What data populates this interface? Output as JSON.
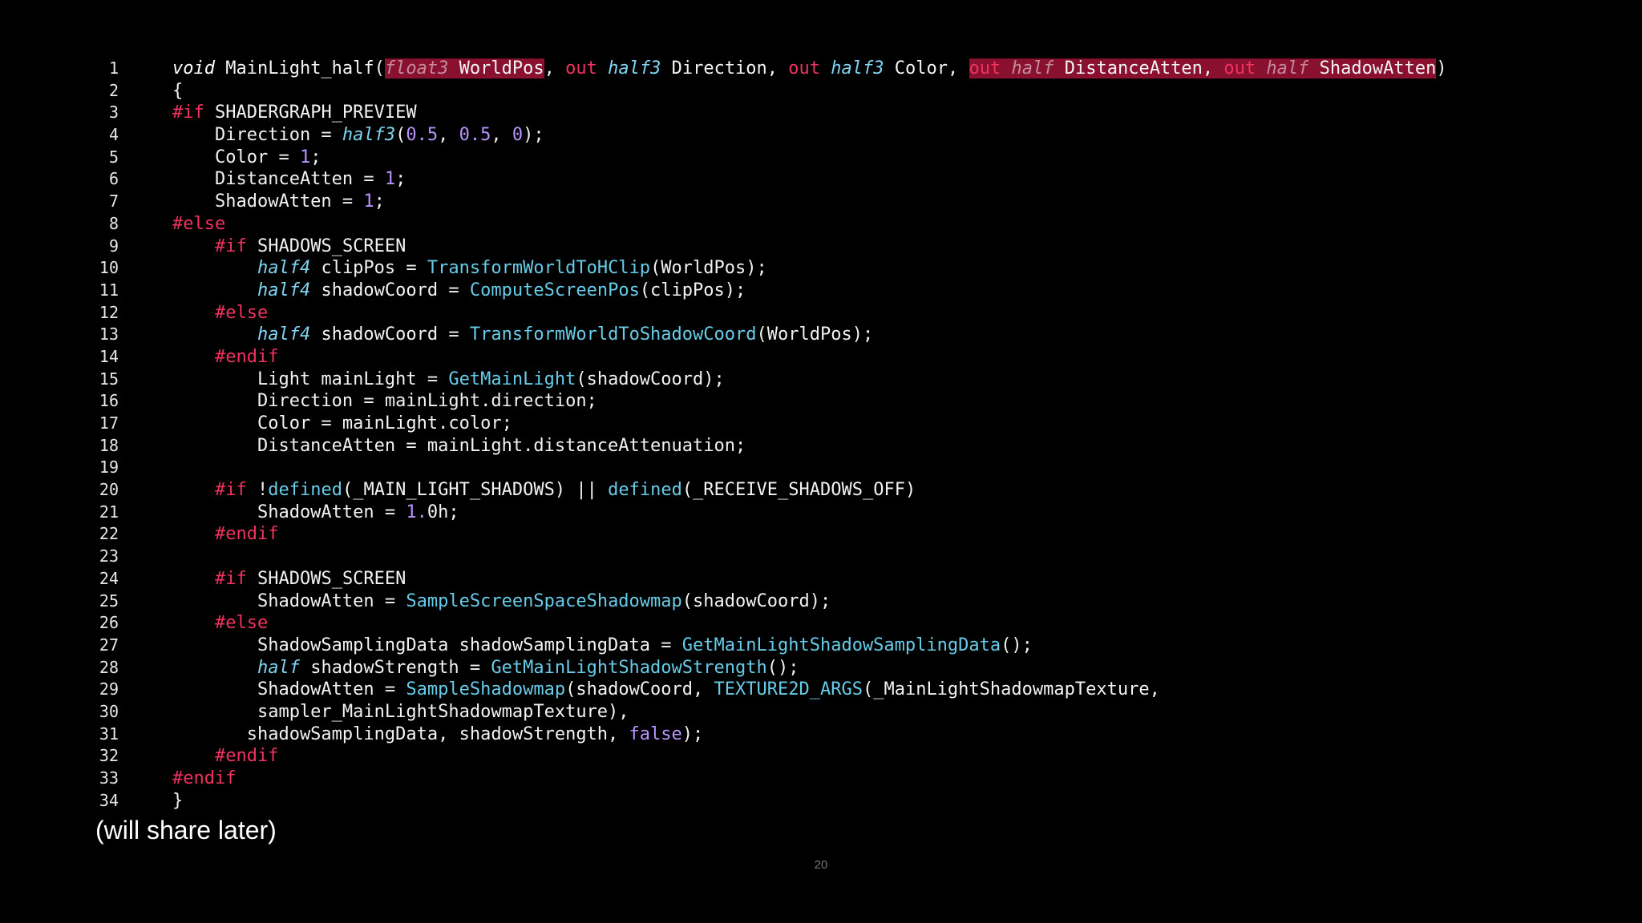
{
  "slide": {
    "caption": "(will share later)",
    "page_number": "20",
    "colors": {
      "background": "#000000",
      "keyword_red": "#f0325f",
      "type_cyan": "#7fd3f2",
      "function_cyan": "#66cce8",
      "number_purple": "#b794ff",
      "highlight_bg": "#8a1030",
      "text": "#f2f2f2"
    }
  },
  "code": {
    "language": "hlsl",
    "lines": [
      {
        "n": "1",
        "tokens": [
          {
            "t": "void",
            "c": "keyword"
          },
          {
            "t": " MainLight_half(",
            "c": "plain"
          },
          {
            "t": "float3",
            "c": "hl-type"
          },
          {
            "t": " WorldPos",
            "c": "hl"
          },
          {
            "t": ", ",
            "c": "plain"
          },
          {
            "t": "out",
            "c": "outkw"
          },
          {
            "t": " ",
            "c": "plain"
          },
          {
            "t": "half3",
            "c": "type"
          },
          {
            "t": " Direction, ",
            "c": "plain"
          },
          {
            "t": "out",
            "c": "outkw"
          },
          {
            "t": " ",
            "c": "plain"
          },
          {
            "t": "half3",
            "c": "type"
          },
          {
            "t": " Color, ",
            "c": "plain"
          },
          {
            "t": "out",
            "c": "hl-out"
          },
          {
            "t": " ",
            "c": "hl"
          },
          {
            "t": "half",
            "c": "hl-type"
          },
          {
            "t": " DistanceAtten, ",
            "c": "hl"
          },
          {
            "t": "out",
            "c": "hl-out"
          },
          {
            "t": " ",
            "c": "hl"
          },
          {
            "t": "half",
            "c": "hl-type"
          },
          {
            "t": " ShadowAtten",
            "c": "hl"
          },
          {
            "t": ")",
            "c": "plain"
          }
        ]
      },
      {
        "n": "2",
        "tokens": [
          {
            "t": "{",
            "c": "plain"
          }
        ]
      },
      {
        "n": "3",
        "tokens": [
          {
            "t": "#if",
            "c": "directive"
          },
          {
            "t": " SHADERGRAPH_PREVIEW",
            "c": "plain"
          }
        ]
      },
      {
        "n": "4",
        "tokens": [
          {
            "t": "    Direction = ",
            "c": "plain"
          },
          {
            "t": "half3",
            "c": "type"
          },
          {
            "t": "(",
            "c": "plain"
          },
          {
            "t": "0.5",
            "c": "number"
          },
          {
            "t": ", ",
            "c": "plain"
          },
          {
            "t": "0.5",
            "c": "number"
          },
          {
            "t": ", ",
            "c": "plain"
          },
          {
            "t": "0",
            "c": "number"
          },
          {
            "t": ");",
            "c": "plain"
          }
        ]
      },
      {
        "n": "5",
        "tokens": [
          {
            "t": "    Color = ",
            "c": "plain"
          },
          {
            "t": "1",
            "c": "number"
          },
          {
            "t": ";",
            "c": "plain"
          }
        ]
      },
      {
        "n": "6",
        "tokens": [
          {
            "t": "    DistanceAtten = ",
            "c": "plain"
          },
          {
            "t": "1",
            "c": "number"
          },
          {
            "t": ";",
            "c": "plain"
          }
        ]
      },
      {
        "n": "7",
        "tokens": [
          {
            "t": "    ShadowAtten = ",
            "c": "plain"
          },
          {
            "t": "1",
            "c": "number"
          },
          {
            "t": ";",
            "c": "plain"
          }
        ]
      },
      {
        "n": "8",
        "tokens": [
          {
            "t": "#else",
            "c": "directive"
          }
        ]
      },
      {
        "n": "9",
        "tokens": [
          {
            "t": "    ",
            "c": "plain"
          },
          {
            "t": "#if",
            "c": "directive"
          },
          {
            "t": " SHADOWS_SCREEN",
            "c": "plain"
          }
        ]
      },
      {
        "n": "10",
        "tokens": [
          {
            "t": "        ",
            "c": "plain"
          },
          {
            "t": "half4",
            "c": "type"
          },
          {
            "t": " clipPos = ",
            "c": "plain"
          },
          {
            "t": "TransformWorldToHClip",
            "c": "func"
          },
          {
            "t": "(WorldPos);",
            "c": "plain"
          }
        ]
      },
      {
        "n": "11",
        "tokens": [
          {
            "t": "        ",
            "c": "plain"
          },
          {
            "t": "half4",
            "c": "type"
          },
          {
            "t": " shadowCoord = ",
            "c": "plain"
          },
          {
            "t": "ComputeScreenPos",
            "c": "func"
          },
          {
            "t": "(clipPos);",
            "c": "plain"
          }
        ]
      },
      {
        "n": "12",
        "tokens": [
          {
            "t": "    ",
            "c": "plain"
          },
          {
            "t": "#else",
            "c": "directive"
          }
        ]
      },
      {
        "n": "13",
        "tokens": [
          {
            "t": "        ",
            "c": "plain"
          },
          {
            "t": "half4",
            "c": "type"
          },
          {
            "t": " shadowCoord = ",
            "c": "plain"
          },
          {
            "t": "TransformWorldToShadowCoord",
            "c": "func"
          },
          {
            "t": "(WorldPos);",
            "c": "plain"
          }
        ]
      },
      {
        "n": "14",
        "tokens": [
          {
            "t": "    ",
            "c": "plain"
          },
          {
            "t": "#endif",
            "c": "directive"
          }
        ]
      },
      {
        "n": "15",
        "tokens": [
          {
            "t": "        Light mainLight = ",
            "c": "plain"
          },
          {
            "t": "GetMainLight",
            "c": "func"
          },
          {
            "t": "(shadowCoord);",
            "c": "plain"
          }
        ]
      },
      {
        "n": "16",
        "tokens": [
          {
            "t": "        Direction = mainLight.direction;",
            "c": "plain"
          }
        ]
      },
      {
        "n": "17",
        "tokens": [
          {
            "t": "        Color = mainLight.color;",
            "c": "plain"
          }
        ]
      },
      {
        "n": "18",
        "tokens": [
          {
            "t": "        DistanceAtten = mainLight.distanceAttenuation;",
            "c": "plain"
          }
        ]
      },
      {
        "n": "19",
        "tokens": []
      },
      {
        "n": "20",
        "tokens": [
          {
            "t": "    ",
            "c": "plain"
          },
          {
            "t": "#if",
            "c": "directive"
          },
          {
            "t": " !",
            "c": "plain"
          },
          {
            "t": "defined",
            "c": "func"
          },
          {
            "t": "(_MAIN_LIGHT_SHADOWS) || ",
            "c": "plain"
          },
          {
            "t": "defined",
            "c": "func"
          },
          {
            "t": "(_RECEIVE_SHADOWS_OFF)",
            "c": "plain"
          }
        ]
      },
      {
        "n": "21",
        "tokens": [
          {
            "t": "        ShadowAtten = ",
            "c": "plain"
          },
          {
            "t": "1.",
            "c": "number"
          },
          {
            "t": "0h;",
            "c": "plain"
          }
        ]
      },
      {
        "n": "22",
        "tokens": [
          {
            "t": "    ",
            "c": "plain"
          },
          {
            "t": "#endif",
            "c": "directive"
          }
        ]
      },
      {
        "n": "23",
        "tokens": []
      },
      {
        "n": "24",
        "tokens": [
          {
            "t": "    ",
            "c": "plain"
          },
          {
            "t": "#if",
            "c": "directive"
          },
          {
            "t": " SHADOWS_SCREEN",
            "c": "plain"
          }
        ]
      },
      {
        "n": "25",
        "tokens": [
          {
            "t": "        ShadowAtten = ",
            "c": "plain"
          },
          {
            "t": "SampleScreenSpaceShadowmap",
            "c": "func"
          },
          {
            "t": "(shadowCoord);",
            "c": "plain"
          }
        ]
      },
      {
        "n": "26",
        "tokens": [
          {
            "t": "    ",
            "c": "plain"
          },
          {
            "t": "#else",
            "c": "directive"
          }
        ]
      },
      {
        "n": "27",
        "tokens": [
          {
            "t": "        ShadowSamplingData shadowSamplingData = ",
            "c": "plain"
          },
          {
            "t": "GetMainLightShadowSamplingData",
            "c": "func"
          },
          {
            "t": "();",
            "c": "plain"
          }
        ]
      },
      {
        "n": "28",
        "tokens": [
          {
            "t": "        ",
            "c": "plain"
          },
          {
            "t": "half",
            "c": "type"
          },
          {
            "t": " shadowStrength = ",
            "c": "plain"
          },
          {
            "t": "GetMainLightShadowStrength",
            "c": "func"
          },
          {
            "t": "();",
            "c": "plain"
          }
        ]
      },
      {
        "n": "29",
        "tokens": [
          {
            "t": "        ShadowAtten = ",
            "c": "plain"
          },
          {
            "t": "SampleShadowmap",
            "c": "func"
          },
          {
            "t": "(shadowCoord, ",
            "c": "plain"
          },
          {
            "t": "TEXTURE2D_ARGS",
            "c": "func"
          },
          {
            "t": "(_MainLightShadowmapTexture,",
            "c": "plain"
          }
        ]
      },
      {
        "n": "30",
        "tokens": [
          {
            "t": "        sampler_MainLightShadowmapTexture),",
            "c": "plain"
          }
        ]
      },
      {
        "n": "31",
        "tokens": [
          {
            "t": "       shadowSamplingData, shadowStrength, ",
            "c": "plain"
          },
          {
            "t": "false",
            "c": "number"
          },
          {
            "t": ");",
            "c": "plain"
          }
        ]
      },
      {
        "n": "32",
        "tokens": [
          {
            "t": "    ",
            "c": "plain"
          },
          {
            "t": "#endif",
            "c": "directive"
          }
        ]
      },
      {
        "n": "33",
        "tokens": [
          {
            "t": "#endif",
            "c": "directive"
          }
        ]
      },
      {
        "n": "34",
        "tokens": [
          {
            "t": "}",
            "c": "plain"
          }
        ]
      }
    ]
  }
}
